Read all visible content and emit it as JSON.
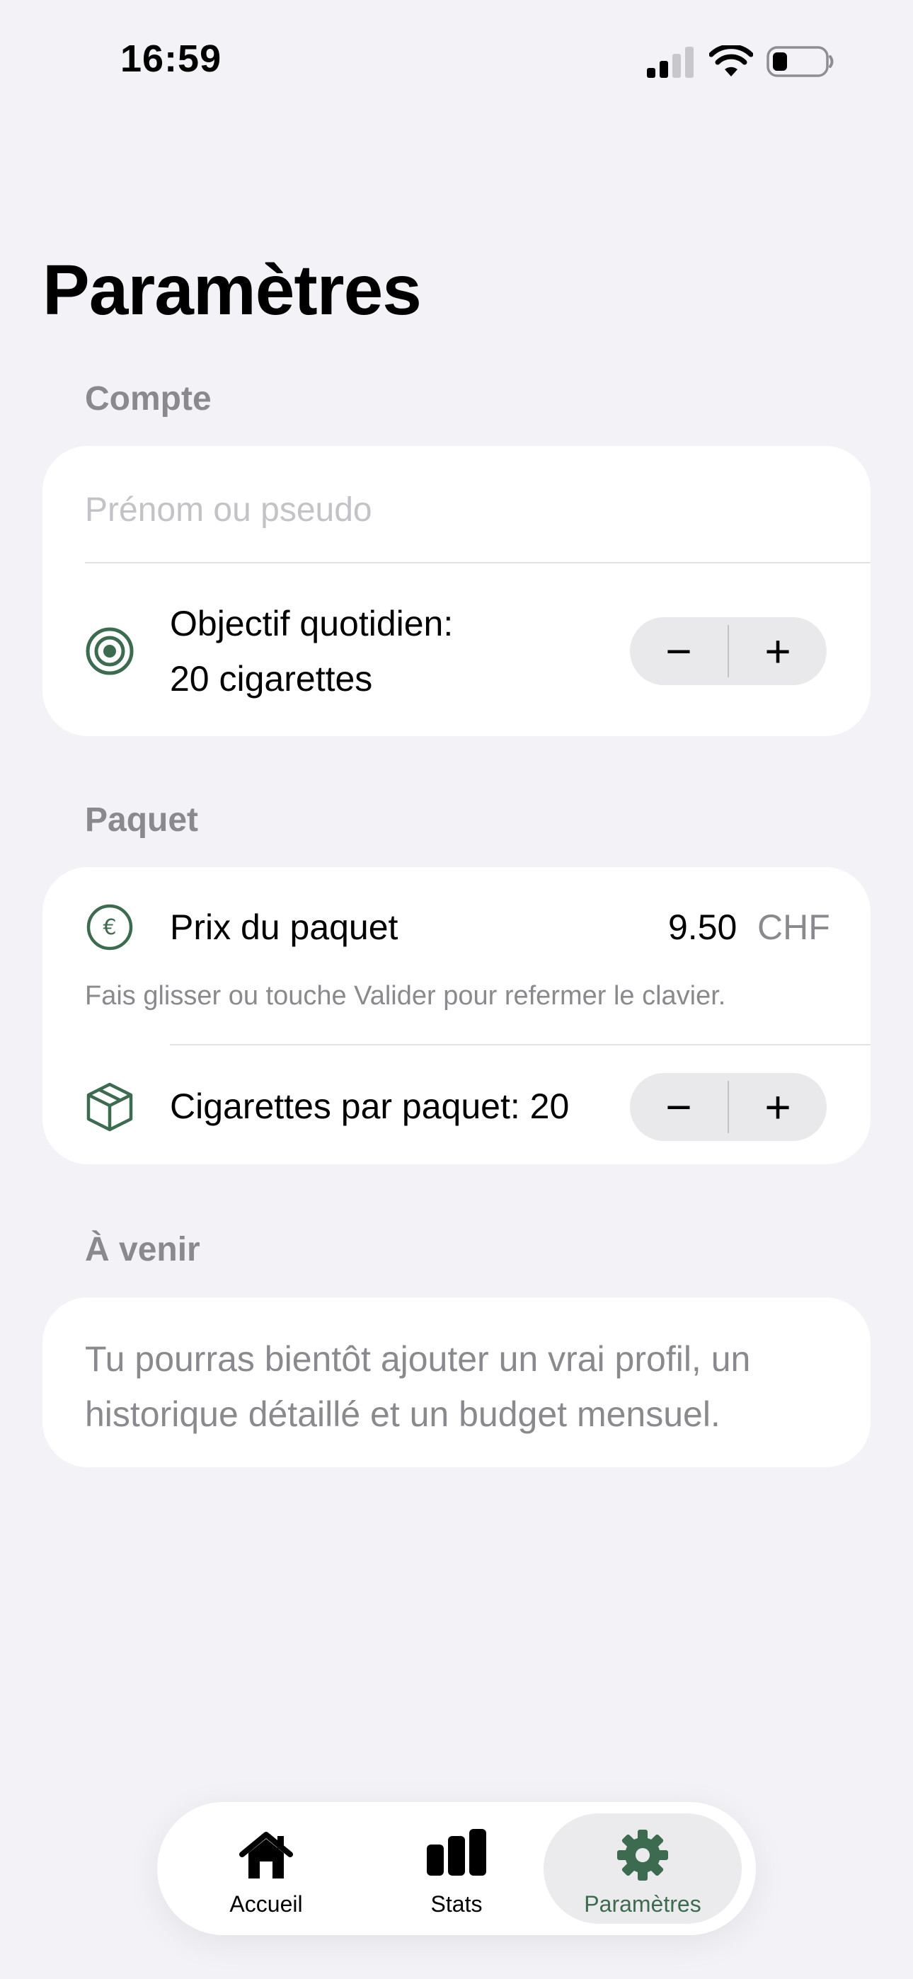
{
  "status_bar": {
    "time": "16:59",
    "icons": [
      "cellular-signal-icon",
      "wifi-icon",
      "battery-icon"
    ]
  },
  "page": {
    "title": "Paramètres"
  },
  "account": {
    "section_title": "Compte",
    "name_input": {
      "value": "",
      "placeholder": "Prénom ou pseudo"
    },
    "daily_goal": {
      "label_line1": "Objectif quotidien:",
      "label_line2": "20 cigarettes",
      "icon": "target-icon",
      "decrement": "−",
      "increment": "+"
    }
  },
  "pack": {
    "section_title": "Paquet",
    "price": {
      "label": "Prix du paquet",
      "value": "9.50",
      "currency": "CHF",
      "icon": "euro-icon"
    },
    "hint": "Fais glisser ou touche Valider pour refermer le clavier.",
    "cigarettes_per_pack": {
      "label": "Cigarettes par paquet: 20",
      "icon": "box-icon",
      "decrement": "−",
      "increment": "+"
    }
  },
  "upcoming": {
    "section_title": "À venir",
    "line1": "Tu pourras bientôt ajouter un vrai profil, un",
    "line2": "historique détaillé et un budget mensuel."
  },
  "tab_bar": {
    "tabs": [
      {
        "label": "Accueil",
        "icon": "house-icon",
        "active": false
      },
      {
        "label": "Stats",
        "icon": "bar-chart-icon",
        "active": false
      },
      {
        "label": "Paramètres",
        "icon": "gear-icon",
        "active": true
      }
    ]
  },
  "colors": {
    "accent": "#3d6b4f",
    "background": "#f2f2f7",
    "card": "#ffffff",
    "secondary_text": "#8a8a8e"
  }
}
